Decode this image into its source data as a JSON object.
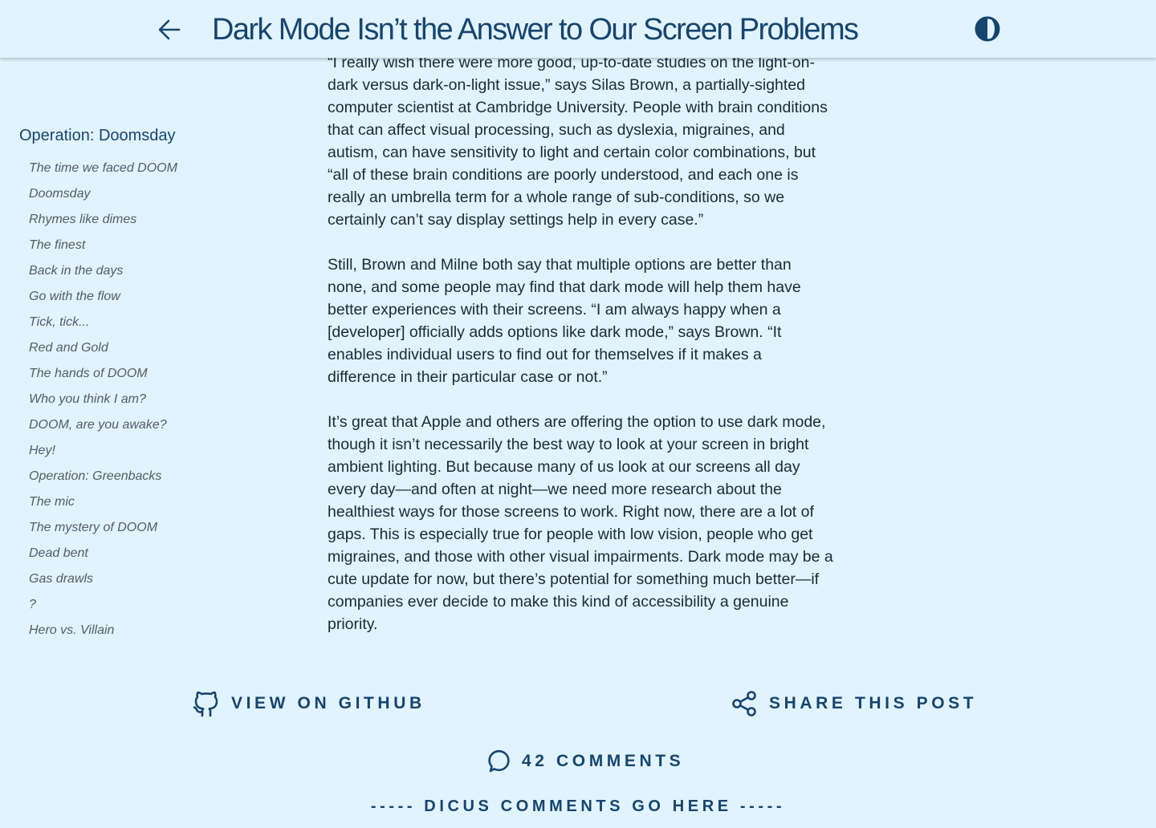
{
  "header": {
    "title": "Dark Mode Isn’t the Answer to Our Screen Problems",
    "back_icon": "arrow-left-icon",
    "theme_icon": "half-moon-contrast-icon"
  },
  "toc": {
    "heading": "Operation: Doomsday",
    "items": [
      "The time we faced DOOM",
      "Doomsday",
      "Rhymes like dimes",
      "The finest",
      "Back in the days",
      "Go with the flow",
      "Tick, tick...",
      "Red and Gold",
      "The hands of DOOM",
      "Who you think I am?",
      "DOOM, are you awake?",
      "Hey!",
      "Operation: Greenbacks",
      "The mic",
      "The mystery of DOOM",
      "Dead bent",
      "Gas drawls",
      "?",
      "Hero vs. Villain"
    ]
  },
  "article": {
    "paragraphs": [
      "“I really wish there were more good, up-to-date studies on the light-on-dark versus dark-on-light issue,” says Silas Brown, a partially-sighted computer scientist at Cambridge University. People with brain conditions that can affect visual processing, such as dyslexia, migraines, and autism, can have sensitivity to light and certain color combinations, but “all of these brain conditions are poorly understood, and each one is really an umbrella term for a whole range of sub-conditions, so we certainly can’t say display settings help in every case.”",
      "Still, Brown and Milne both say that multiple options are better than none, and some people may find that dark mode will help them have better experiences with their screens. “I am always happy when a [developer] officially adds options like dark mode,” says Brown. “It enables individual users to find out for themselves if it makes a difference in their particular case or not.”",
      "It’s great that Apple and others are offering the option to use dark mode, though it isn’t necessarily the best way to look at your screen in bright ambient lighting. But because many of us look at our screens all day every day—and often at night—we need more research about the healthiest ways for those screens to work. Right now, there are a lot of gaps. This is especially true for people with low vision, people who get migraines, and those with other visual impairments. Dark mode may be a cute update for now, but there’s potential for something much better—if companies ever decide to make this kind of accessibility a genuine priority."
    ]
  },
  "footer": {
    "github_label": "VIEW ON GITHUB",
    "share_label": "SHARE THIS POST",
    "comments_label": "42 COMMENTS",
    "comments_placeholder": "----- DICUS COMMENTS GO HERE -----",
    "github_icon": "github-icon",
    "share_icon": "share-icon",
    "comment_icon": "speech-bubble-icon"
  },
  "colors": {
    "background": "#e1f3fe",
    "accent": "#16456e",
    "body_text": "#1c2a36",
    "toc_item": "#555c63"
  }
}
